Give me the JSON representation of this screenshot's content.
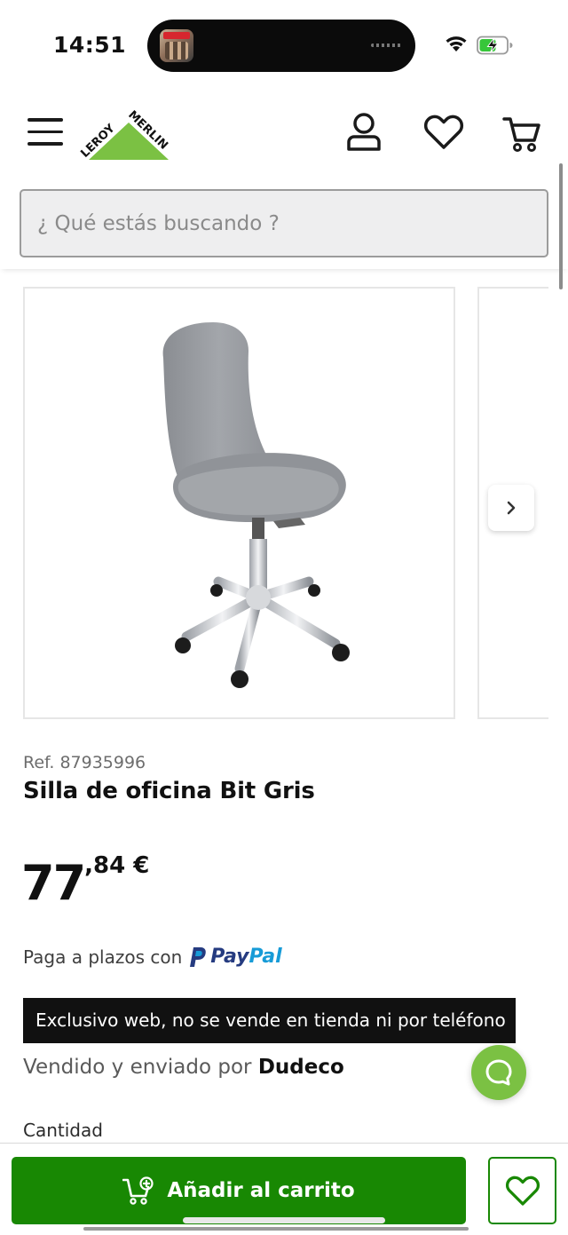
{
  "status_bar": {
    "time": "14:51",
    "island_icons": [
      "album-thumbnail-icon",
      "audio-wave-icon"
    ],
    "right_icons": [
      "wifi-icon",
      "battery-charging-icon"
    ]
  },
  "header": {
    "brand": "LEROY MERLIN",
    "brand_color": "#7bc143",
    "icons": [
      "menu-icon",
      "account-icon",
      "heart-icon",
      "cart-icon"
    ],
    "search_placeholder": "¿ Qué estás buscando ?"
  },
  "gallery": {
    "image": "grey-office-chair",
    "next_icon": "chevron-right-icon"
  },
  "product": {
    "ref_label": "Ref.",
    "ref_number": "87935996",
    "title": "Silla de oficina Bit Gris",
    "price_integer": "77",
    "price_decimal": ",84 €",
    "paypal_text": "Paga a plazos con",
    "paypal_brand_a": "Pay",
    "paypal_brand_b": "Pal",
    "badge": "Exclusivo web, no se vende en tienda ni por teléfono",
    "seller_prefix": "Vendido y enviado por",
    "seller_name": "Dudeco",
    "quantity_label": "Cantidad"
  },
  "bottom_bar": {
    "add_to_cart": "Añadir al carrito",
    "accent": "#188803"
  },
  "chat": {
    "icon": "chat-bubble-icon",
    "color": "#7bc143"
  }
}
